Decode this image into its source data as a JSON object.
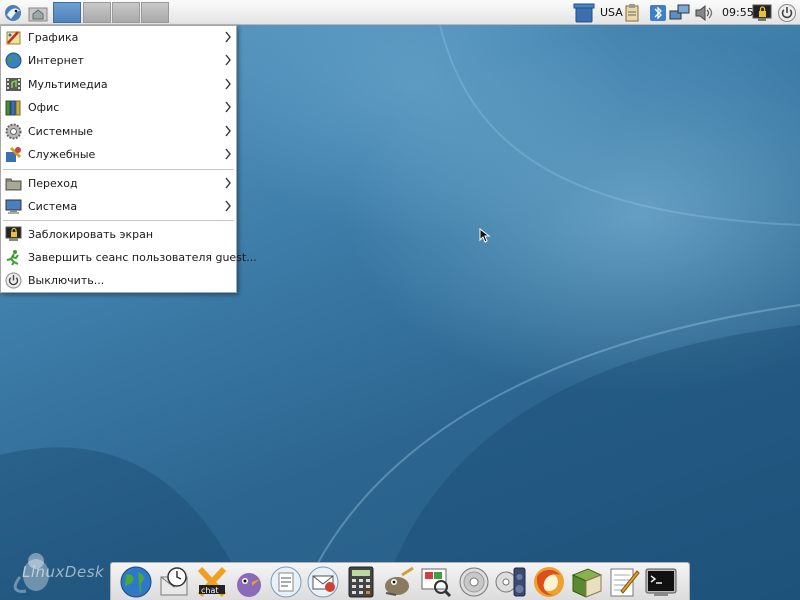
{
  "top_panel": {
    "keyboard_layout": "USA",
    "clock": "09:55"
  },
  "menu": {
    "items": [
      {
        "label": "Графика",
        "icon": "graphics-icon",
        "submenu": true
      },
      {
        "label": "Интернет",
        "icon": "internet-globe-icon",
        "submenu": true
      },
      {
        "label": "Мультимедиа",
        "icon": "multimedia-icon",
        "submenu": true
      },
      {
        "label": "Офис",
        "icon": "office-icon",
        "submenu": true
      },
      {
        "label": "Системные",
        "icon": "system-gear-icon",
        "submenu": true
      },
      {
        "label": "Служебные",
        "icon": "accessories-icon",
        "submenu": true
      },
      {
        "label": "Переход",
        "icon": "places-folder-icon",
        "submenu": true
      },
      {
        "label": "Система",
        "icon": "computer-monitor-icon",
        "submenu": true
      },
      {
        "label": "Заблокировать экран",
        "icon": "lock-screen-icon",
        "submenu": false
      },
      {
        "label": "Завершить сеанс пользователя guest...",
        "icon": "logout-running-man-icon",
        "submenu": false
      },
      {
        "label": "Выключить...",
        "icon": "power-icon",
        "submenu": false
      }
    ]
  },
  "dock": {
    "icons": [
      "web-browser-globe-icon",
      "mail-clock-icon",
      "xchat-icon",
      "pidgin-icon",
      "document-viewer-icon",
      "mail-client-icon",
      "calculator-icon",
      "gimp-icon",
      "image-viewer-icon",
      "cd-burner-icon",
      "media-player-icon",
      "firefox-icon",
      "dictionary-books-icon",
      "text-editor-icon",
      "terminal-icon"
    ]
  },
  "watermark": {
    "text": "LinuxDesk"
  },
  "colors": {
    "desktop_base": "#2e6690",
    "panel_bg": "#e9e9e9",
    "active_workspace": "#5a8ec4"
  }
}
